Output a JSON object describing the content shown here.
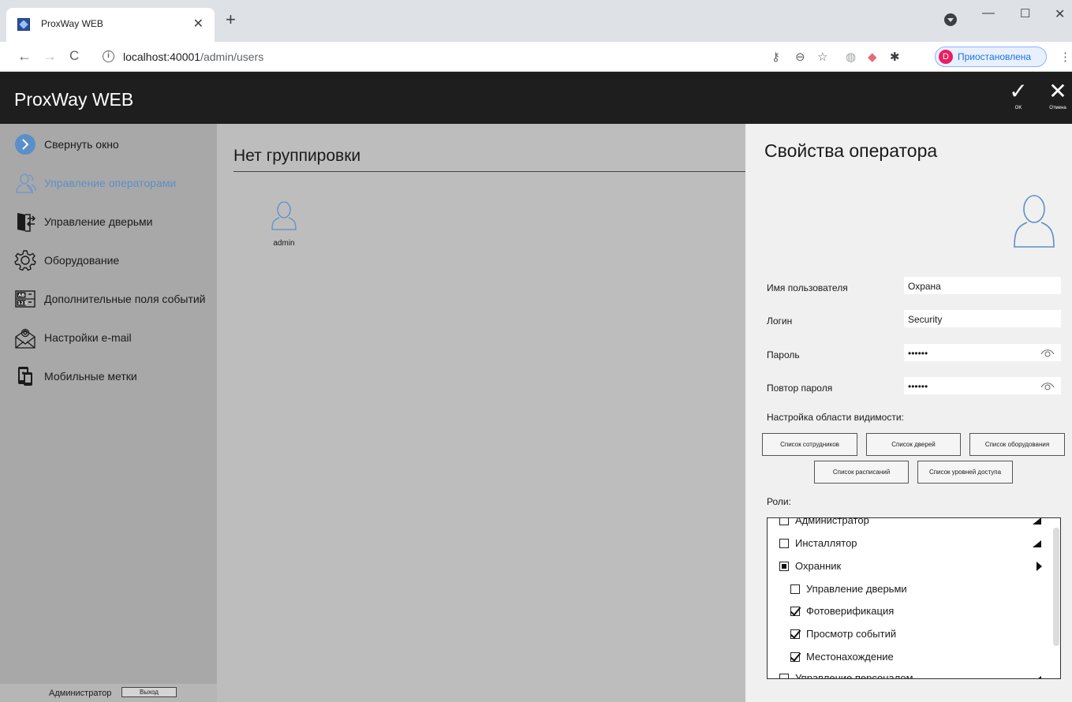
{
  "browser": {
    "tab_title": "ProxWay WEB",
    "url_host": "localhost:40001",
    "url_path": "/admin/users",
    "profile_initial": "D",
    "profile_status": "Приостановлена"
  },
  "app": {
    "title": "ProxWay WEB",
    "ok_label": "OK",
    "cancel_label": "Отмена"
  },
  "sidebar": {
    "items": [
      {
        "label": "Свернуть окно",
        "icon": "collapse-icon"
      },
      {
        "label": "Управление операторами",
        "icon": "operators-icon",
        "active": true
      },
      {
        "label": "Управление дверьми",
        "icon": "door-icon"
      },
      {
        "label": "Оборудование",
        "icon": "gear-icon"
      },
      {
        "label": "Дополнительные поля событий",
        "icon": "fields-icon"
      },
      {
        "label": "Настройки e-mail",
        "icon": "email-icon"
      },
      {
        "label": "Мобильные метки",
        "icon": "mobile-icon"
      }
    ],
    "footer_user": "Администратор",
    "logout_label": "Выход"
  },
  "main": {
    "group_title": "Нет группировки",
    "users": [
      {
        "name": "admin"
      }
    ]
  },
  "panel": {
    "title": "Свойства оператора",
    "fields": {
      "username_label": "Имя пользователя",
      "username_value": "Охрана",
      "login_label": "Логин",
      "login_value": "Security",
      "password_label": "Пароль",
      "password_value": "••••••",
      "password_repeat_label": "Повтор пароля",
      "password_repeat_value": "••••••"
    },
    "scope_label": "Настройка области видимости:",
    "scope_buttons": [
      "Список сотрудников",
      "Список дверей",
      "Список оборудования",
      "Список расписаний",
      "Список уровней доступа"
    ],
    "roles_label": "Роли:",
    "roles": [
      {
        "label": "Администратор",
        "state": "unchecked",
        "expander": "open"
      },
      {
        "label": "Инсталлятор",
        "state": "unchecked",
        "expander": "open"
      },
      {
        "label": "Охранник",
        "state": "partial",
        "expander": "closed"
      },
      {
        "label": "Управление дверьми",
        "state": "unchecked"
      },
      {
        "label": "Фотоверификация",
        "state": "checked"
      },
      {
        "label": "Просмотр событий",
        "state": "checked"
      },
      {
        "label": "Местонахождение",
        "state": "checked"
      },
      {
        "label": "Управление персоналом",
        "state": "unchecked",
        "expander": "open"
      }
    ]
  }
}
